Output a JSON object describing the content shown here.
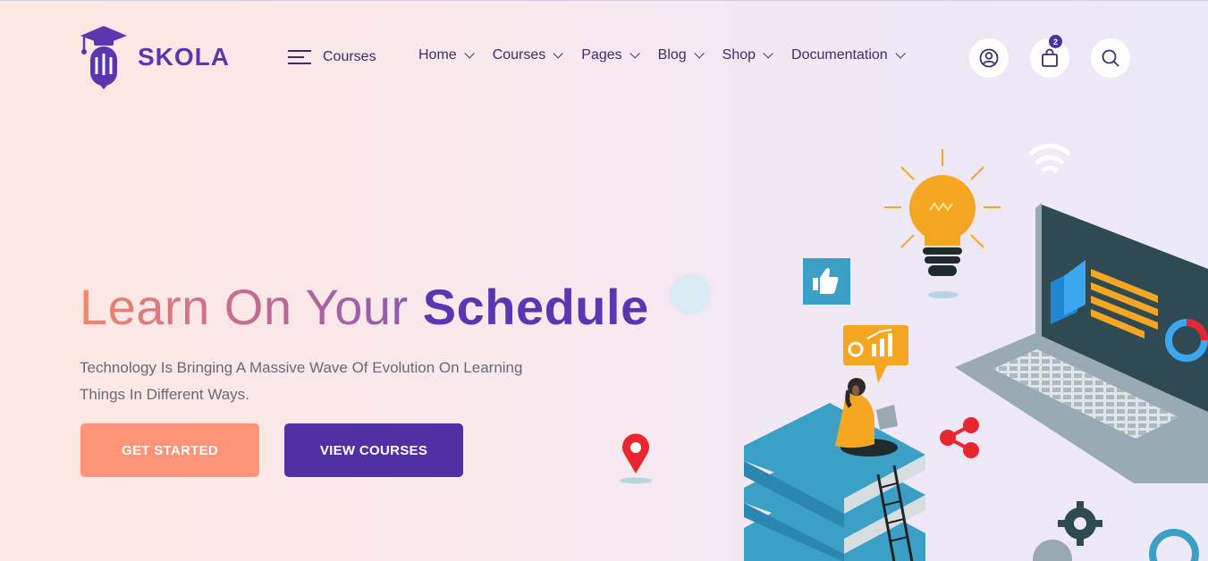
{
  "brand": {
    "name": "SKOLA",
    "logo_icon": "graduation-cap-pencil-icon"
  },
  "category_menu": {
    "label": "Courses",
    "icon": "hamburger-icon"
  },
  "nav": {
    "items": [
      {
        "label": "Home"
      },
      {
        "label": "Courses"
      },
      {
        "label": "Pages"
      },
      {
        "label": "Blog"
      },
      {
        "label": "Shop"
      },
      {
        "label": "Documentation"
      }
    ]
  },
  "header_actions": {
    "account_icon": "user-circle-icon",
    "cart_icon": "shopping-bag-icon",
    "cart_count": "2",
    "search_icon": "search-icon"
  },
  "hero": {
    "title_light": "Learn On Your",
    "title_bold": "Schedule",
    "subtitle": "Technology Is Bringing A Massive Wave Of Evolution On Learning Things In Different Ways.",
    "primary_button": "GET STARTED",
    "secondary_button": "VIEW COURSES"
  },
  "colors": {
    "brand_purple": "#5a37b0",
    "nav_text": "#3d2c6e",
    "primary_button": "#ff9478",
    "secondary_button": "#4f31a3"
  }
}
